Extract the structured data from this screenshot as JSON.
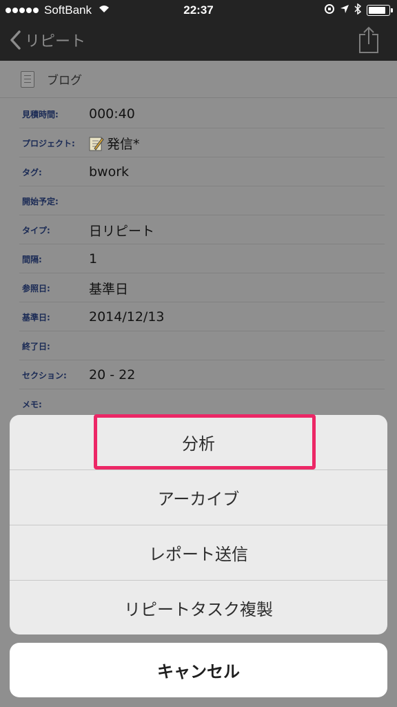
{
  "status_bar": {
    "carrier": "SoftBank",
    "time": "22:37",
    "signal_bars": 5,
    "battery_level": 0.9
  },
  "nav": {
    "back_label": "リピート",
    "share_icon": "share-icon"
  },
  "detail": {
    "title": "ブログ",
    "fields": [
      {
        "key": "見積時間:",
        "value": "000:40"
      },
      {
        "key": "プロジェクト:",
        "value": "発信*",
        "icon": "pencil-note-icon"
      },
      {
        "key": "タグ:",
        "value": "bwork"
      },
      {
        "key": "開始予定:",
        "value": ""
      },
      {
        "key": "タイプ:",
        "value": "日リピート"
      },
      {
        "key": "間隔:",
        "value": "1"
      },
      {
        "key": "参照日:",
        "value": "基準日"
      },
      {
        "key": "基準日:",
        "value": "2014/12/13"
      },
      {
        "key": "終了日:",
        "value": ""
      },
      {
        "key": "セクション:",
        "value": "20 - 22"
      },
      {
        "key": "メモ:",
        "value": ""
      }
    ]
  },
  "action_sheet": {
    "items": [
      "分析",
      "アーカイブ",
      "レポート送信",
      "リピートタスク複製"
    ],
    "cancel": "キャンセル",
    "highlight_color": "#ec2766"
  }
}
